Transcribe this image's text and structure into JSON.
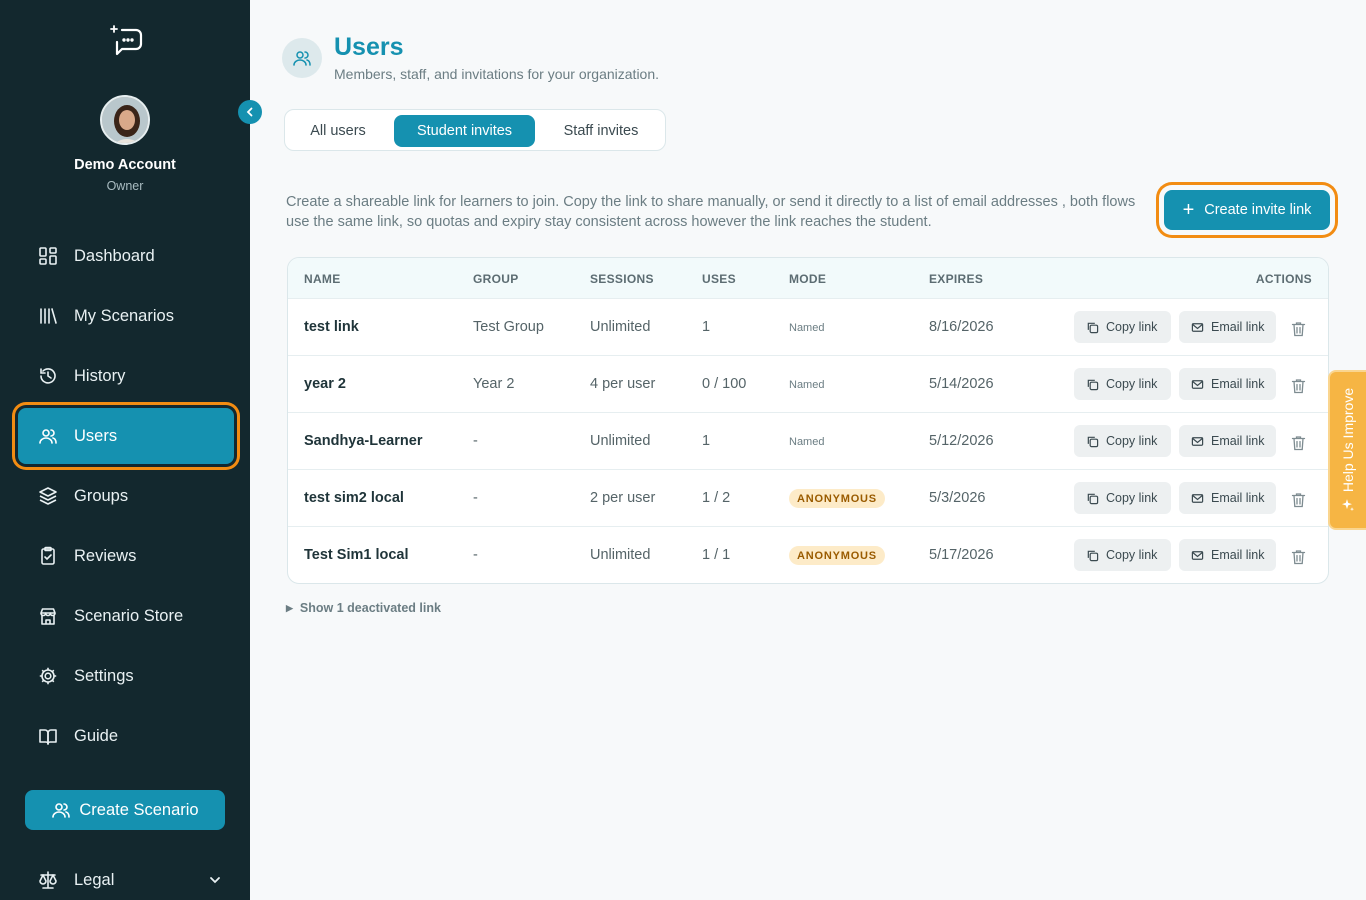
{
  "account": {
    "name": "Demo Account",
    "role": "Owner"
  },
  "nav": {
    "items": [
      {
        "label": "Dashboard",
        "icon": "dashboard-icon"
      },
      {
        "label": "My Scenarios",
        "icon": "library-icon"
      },
      {
        "label": "History",
        "icon": "history-icon"
      },
      {
        "label": "Users",
        "icon": "users-icon",
        "active": true
      },
      {
        "label": "Groups",
        "icon": "layers-icon"
      },
      {
        "label": "Reviews",
        "icon": "clipboard-check-icon"
      },
      {
        "label": "Scenario Store",
        "icon": "store-icon"
      },
      {
        "label": "Settings",
        "icon": "gear-icon"
      },
      {
        "label": "Guide",
        "icon": "book-open-icon"
      }
    ],
    "create_scenario": "Create Scenario",
    "legal": "Legal"
  },
  "header": {
    "title": "Users",
    "subtitle": "Members, staff, and invitations for your organization."
  },
  "tabs": [
    {
      "label": "All users",
      "active": false
    },
    {
      "label": "Student invites",
      "active": true
    },
    {
      "label": "Staff invites",
      "active": false
    }
  ],
  "description": "Create a shareable link for learners to join. Copy the link to share manually, or send it directly to a list of email addresses , both flows use the same link, so quotas and expiry stay consistent across however the link reaches the student.",
  "create_invite_label": "Create invite link",
  "table": {
    "columns": [
      "NAME",
      "GROUP",
      "SESSIONS",
      "USES",
      "MODE",
      "EXPIRES",
      "ACTIONS"
    ],
    "rows": [
      {
        "name": "test link",
        "group": "Test Group",
        "sessions": "Unlimited",
        "uses": "1",
        "mode": "Named",
        "expires": "8/16/2026"
      },
      {
        "name": "year 2",
        "group": "Year 2",
        "sessions": "4 per user",
        "uses": "0 / 100",
        "mode": "Named",
        "expires": "5/14/2026"
      },
      {
        "name": "Sandhya-Learner",
        "group": "-",
        "sessions": "Unlimited",
        "uses": "1",
        "mode": "Named",
        "expires": "5/12/2026"
      },
      {
        "name": "test sim2 local",
        "group": "-",
        "sessions": "2 per user",
        "uses": "1 / 2",
        "mode": "ANONYMOUS",
        "expires": "5/3/2026"
      },
      {
        "name": "Test Sim1 local",
        "group": "-",
        "sessions": "Unlimited",
        "uses": "1 / 1",
        "mode": "ANONYMOUS",
        "expires": "5/17/2026"
      }
    ],
    "copy_label": "Copy link",
    "email_label": "Email link"
  },
  "deactivated_label": "Show 1 deactivated link",
  "help_label": "Help Us Improve",
  "colors": {
    "accent": "#1591b0",
    "sidebar": "#13282e",
    "highlight": "#f28c12",
    "badge": "#fdebc8"
  }
}
